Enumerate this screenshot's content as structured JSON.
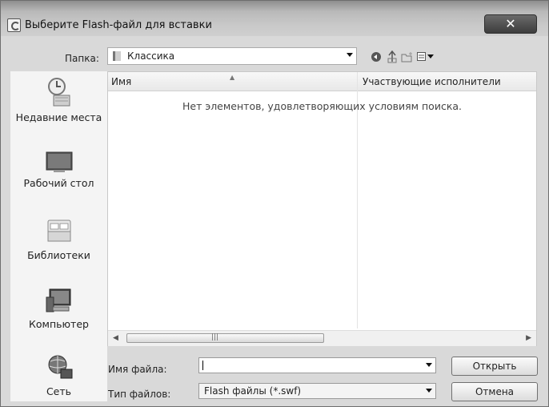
{
  "window": {
    "title": "Выберите Flash-файл для вставки",
    "close_glyph": "✕"
  },
  "toolbar": {
    "folder_label": "Папка:",
    "folder_value": "Классика",
    "icons": [
      "back-icon",
      "up-folder-icon",
      "new-folder-icon",
      "view-menu-icon"
    ]
  },
  "places": [
    {
      "label": "Недавние места",
      "icon": "recent-places-icon"
    },
    {
      "label": "Рабочий стол",
      "icon": "desktop-icon"
    },
    {
      "label": "Библиотеки",
      "icon": "libraries-icon"
    },
    {
      "label": "Компьютер",
      "icon": "computer-icon"
    },
    {
      "label": "Сеть",
      "icon": "network-icon"
    }
  ],
  "file_list": {
    "columns": [
      "Имя",
      "Участвующие исполнители"
    ],
    "empty_message": "Нет элементов, удовлетворяющих условиям поиска."
  },
  "form": {
    "filename_label": "Имя файла:",
    "filename_value": "",
    "filetype_label": "Тип файлов:",
    "filetype_value": "Flash файлы (*.swf)"
  },
  "buttons": {
    "open": "Открыть",
    "cancel": "Отмена"
  }
}
